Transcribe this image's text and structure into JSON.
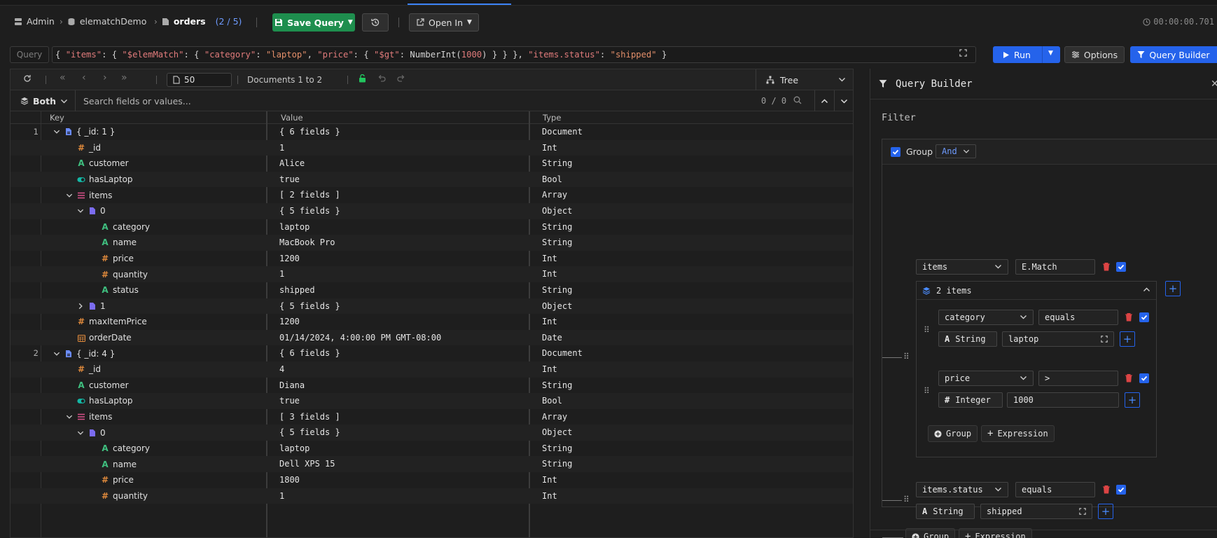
{
  "breadcrumb": {
    "admin": "Admin",
    "database": "elematchDemo",
    "collection": "orders",
    "count": "(2 / 5)"
  },
  "toolbar": {
    "save_label": "Save Query",
    "open_in_label": "Open In",
    "timer": "00:00:00.701"
  },
  "query": {
    "label": "Query",
    "tokens": [
      {
        "t": "{ ",
        "c": "p"
      },
      {
        "t": "\"items\"",
        "c": "k"
      },
      {
        "t": ": { ",
        "c": "p"
      },
      {
        "t": "\"$elemMatch\"",
        "c": "k"
      },
      {
        "t": ": { ",
        "c": "p"
      },
      {
        "t": "\"category\"",
        "c": "k"
      },
      {
        "t": ": ",
        "c": "p"
      },
      {
        "t": "\"laptop\"",
        "c": "s"
      },
      {
        "t": ", ",
        "c": "p"
      },
      {
        "t": "\"price\"",
        "c": "k"
      },
      {
        "t": ": { ",
        "c": "p"
      },
      {
        "t": "\"$gt\"",
        "c": "k"
      },
      {
        "t": ": NumberInt(",
        "c": "f"
      },
      {
        "t": "1000",
        "c": "n"
      },
      {
        "t": ") } } }, ",
        "c": "p"
      },
      {
        "t": "\"items.status\"",
        "c": "k"
      },
      {
        "t": ": ",
        "c": "p"
      },
      {
        "t": "\"shipped\"",
        "c": "s"
      },
      {
        "t": " }",
        "c": "p"
      }
    ],
    "run_label": "Run",
    "options_label": "Options",
    "query_builder_label": "Query Builder"
  },
  "results": {
    "page_size": "50",
    "doc_range": "Documents 1 to 2",
    "view_mode": "Tree",
    "filter_mode": "Both",
    "search_placeholder": "Search fields or values...",
    "match_count": "0 / 0",
    "columns": {
      "key": "Key",
      "value": "Value",
      "type": "Type"
    },
    "rows": [
      {
        "n": "1",
        "depth": 0,
        "toggle": "down",
        "icon": "doc",
        "key": "{ _id: 1 }",
        "value": "{ 6 fields }",
        "type": "Document"
      },
      {
        "n": "",
        "depth": 1,
        "toggle": "",
        "icon": "hash",
        "key": "_id",
        "value": "1",
        "type": "Int"
      },
      {
        "n": "",
        "depth": 1,
        "toggle": "",
        "icon": "str",
        "key": "customer",
        "value": "Alice",
        "type": "String"
      },
      {
        "n": "",
        "depth": 1,
        "toggle": "",
        "icon": "bool",
        "key": "hasLaptop",
        "value": "true",
        "type": "Bool"
      },
      {
        "n": "",
        "depth": 1,
        "toggle": "down",
        "icon": "arr",
        "key": "items",
        "value": "[ 2 fields ]",
        "type": "Array"
      },
      {
        "n": "",
        "depth": 2,
        "toggle": "down",
        "icon": "obj",
        "key": "0",
        "value": "{ 5 fields }",
        "type": "Object"
      },
      {
        "n": "",
        "depth": 3,
        "toggle": "",
        "icon": "str",
        "key": "category",
        "value": "laptop",
        "type": "String"
      },
      {
        "n": "",
        "depth": 3,
        "toggle": "",
        "icon": "str",
        "key": "name",
        "value": "MacBook Pro",
        "type": "String"
      },
      {
        "n": "",
        "depth": 3,
        "toggle": "",
        "icon": "hash",
        "key": "price",
        "value": "1200",
        "type": "Int"
      },
      {
        "n": "",
        "depth": 3,
        "toggle": "",
        "icon": "hash",
        "key": "quantity",
        "value": "1",
        "type": "Int"
      },
      {
        "n": "",
        "depth": 3,
        "toggle": "",
        "icon": "str",
        "key": "status",
        "value": "shipped",
        "type": "String"
      },
      {
        "n": "",
        "depth": 2,
        "toggle": "right",
        "icon": "obj",
        "key": "1",
        "value": "{ 5 fields }",
        "type": "Object"
      },
      {
        "n": "",
        "depth": 1,
        "toggle": "",
        "icon": "hash",
        "key": "maxItemPrice",
        "value": "1200",
        "type": "Int"
      },
      {
        "n": "",
        "depth": 1,
        "toggle": "",
        "icon": "date",
        "key": "orderDate",
        "value": "01/14/2024, 4:00:00 PM GMT-08:00",
        "type": "Date"
      },
      {
        "n": "2",
        "depth": 0,
        "toggle": "down",
        "icon": "doc",
        "key": "{ _id: 4 }",
        "value": "{ 6 fields }",
        "type": "Document"
      },
      {
        "n": "",
        "depth": 1,
        "toggle": "",
        "icon": "hash",
        "key": "_id",
        "value": "4",
        "type": "Int"
      },
      {
        "n": "",
        "depth": 1,
        "toggle": "",
        "icon": "str",
        "key": "customer",
        "value": "Diana",
        "type": "String"
      },
      {
        "n": "",
        "depth": 1,
        "toggle": "",
        "icon": "bool",
        "key": "hasLaptop",
        "value": "true",
        "type": "Bool"
      },
      {
        "n": "",
        "depth": 1,
        "toggle": "down",
        "icon": "arr",
        "key": "items",
        "value": "[ 3 fields ]",
        "type": "Array"
      },
      {
        "n": "",
        "depth": 2,
        "toggle": "down",
        "icon": "obj",
        "key": "0",
        "value": "{ 5 fields }",
        "type": "Object"
      },
      {
        "n": "",
        "depth": 3,
        "toggle": "",
        "icon": "str",
        "key": "category",
        "value": "laptop",
        "type": "String"
      },
      {
        "n": "",
        "depth": 3,
        "toggle": "",
        "icon": "str",
        "key": "name",
        "value": "Dell XPS 15",
        "type": "String"
      },
      {
        "n": "",
        "depth": 3,
        "toggle": "",
        "icon": "hash",
        "key": "price",
        "value": "1800",
        "type": "Int"
      },
      {
        "n": "",
        "depth": 3,
        "toggle": "",
        "icon": "hash",
        "key": "quantity",
        "value": "1",
        "type": "Int"
      }
    ]
  },
  "query_builder": {
    "title": "Query Builder",
    "filter_label": "Filter",
    "group_label": "Group",
    "logic": "And",
    "cond1": {
      "field": "items",
      "operator": "E.Match"
    },
    "sub": {
      "header": "2 items",
      "c1": {
        "field": "category",
        "operator": "equals",
        "type": "String",
        "value": "laptop"
      },
      "c2": {
        "field": "price",
        "operator": ">",
        "type": "Integer",
        "value": "1000"
      },
      "add_group": "Group",
      "add_expression": "Expression"
    },
    "cond2": {
      "field": "items.status",
      "operator": "equals",
      "type": "String",
      "value": "shipped"
    },
    "add_group": "Group",
    "add_expression": "Expression"
  },
  "colors": {
    "accent": "#2563eb",
    "save": "#1e8e4e",
    "string_icon": "#3fbf7f",
    "number_icon": "#e08a3c",
    "array_icon": "#d9508a",
    "doc_icon": "#6b8cff"
  }
}
